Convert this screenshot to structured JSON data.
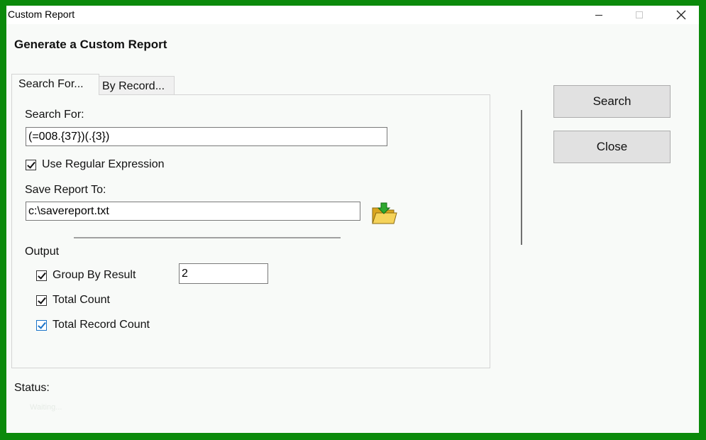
{
  "window": {
    "title": "Custom Report"
  },
  "heading": "Generate a Custom Report",
  "tabs": [
    {
      "label": "Search For...",
      "active": true
    },
    {
      "label": "By Record...",
      "active": false
    }
  ],
  "search": {
    "label": "Search For:",
    "value": "(=008.{37})(.{3})",
    "use_regex_label": "Use Regular Expression",
    "use_regex_checked": true
  },
  "save": {
    "label": "Save Report To:",
    "value": "c:\\savereport.txt",
    "browse_icon": "folder-open-icon"
  },
  "output": {
    "label": "Output",
    "group_by_label": "Group By Result",
    "group_by_checked": true,
    "group_by_value": "2",
    "total_count_label": "Total Count",
    "total_count_checked": true,
    "total_record_count_label": "Total Record Count",
    "total_record_count_checked": true
  },
  "buttons": {
    "search": "Search",
    "close": "Close"
  },
  "status": {
    "label": "Status:",
    "value": "Waiting..."
  },
  "colors": {
    "frame": "#0b8a0b",
    "window_bg": "#f8faf8",
    "button_bg": "#e1e1e1",
    "focus_blue": "#1a73c8"
  }
}
